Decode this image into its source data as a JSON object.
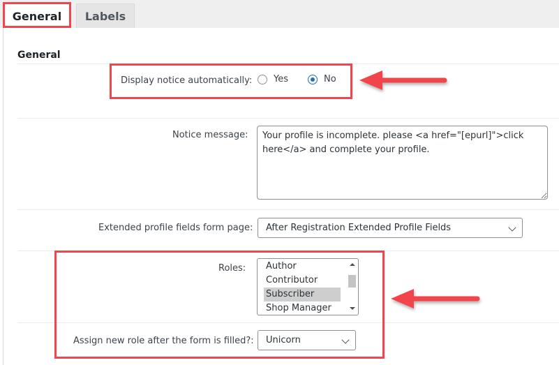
{
  "tabs": [
    {
      "label": "General",
      "active": true
    },
    {
      "label": "Labels",
      "active": false
    }
  ],
  "section": {
    "title": "General"
  },
  "fields": {
    "display_notice": {
      "label": "Display notice automatically:",
      "options": [
        {
          "label": "Yes",
          "checked": false
        },
        {
          "label": "No",
          "checked": true
        }
      ]
    },
    "notice_message": {
      "label": "Notice message:",
      "value": "Your profile is incomplete. please <a href=\"[epurl]\">click here</a> and complete your profile."
    },
    "form_page": {
      "label": "Extended profile fields form page:",
      "value": "After Registration Extended Profile Fields"
    },
    "roles": {
      "label": "Roles:",
      "options": [
        "Author",
        "Contributor",
        "Subscriber",
        "Shop Manager"
      ],
      "selected": "Subscriber"
    },
    "new_role": {
      "label": "Assign new role after the form is filled?:",
      "value": "Unicorn"
    }
  },
  "annotations": {
    "highlight_color": "#f2444c",
    "arrow_color": "#f2444c"
  }
}
